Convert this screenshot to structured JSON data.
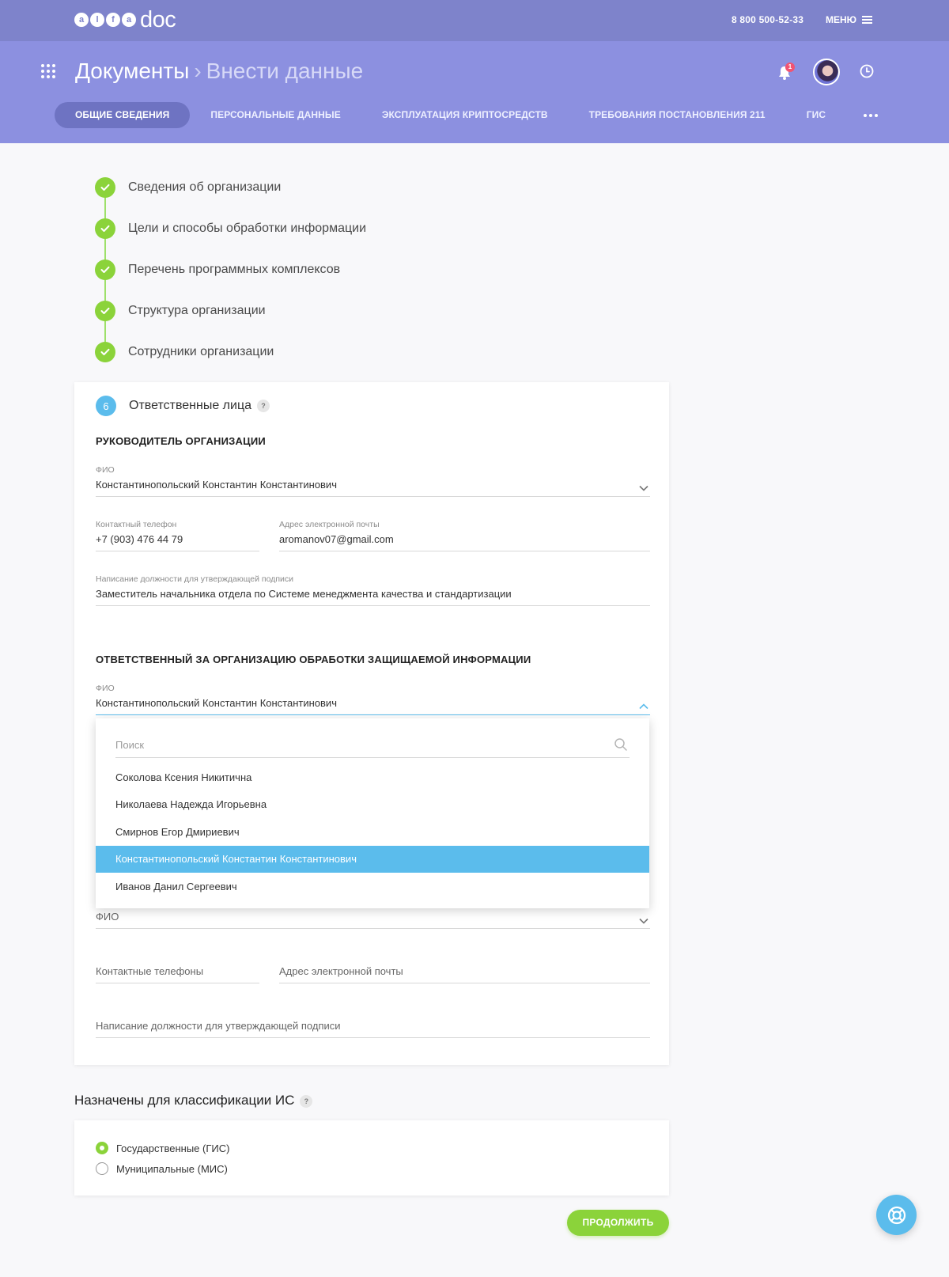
{
  "topbar": {
    "logo_letters": [
      "a",
      "l",
      "f",
      "a"
    ],
    "logo_word": "doc",
    "phone": "8 800  500-52-33",
    "menu_label": "МЕНЮ"
  },
  "header": {
    "breadcrumb_root": "Документы",
    "breadcrumb_separator": "›",
    "breadcrumb_current": "Внести данные",
    "notifications_count": "1",
    "tabs": [
      {
        "label": "ОБЩИЕ СВЕДЕНИЯ",
        "active": true
      },
      {
        "label": "ПЕРСОНАЛЬНЫЕ ДАННЫЕ",
        "active": false
      },
      {
        "label": "ЭКСПЛУАТАЦИЯ КРИПТОСРЕДСТВ",
        "active": false
      },
      {
        "label": "ТРЕБОВАНИЯ ПОСТАНОВЛЕНИЯ 211",
        "active": false
      },
      {
        "label": "ГИС",
        "active": false
      }
    ]
  },
  "steps": [
    {
      "label": "Сведения об организации",
      "done": true
    },
    {
      "label": "Цели и способы обработки информации",
      "done": true
    },
    {
      "label": "Перечень программных комплексов",
      "done": true
    },
    {
      "label": "Структура организации",
      "done": true
    },
    {
      "label": "Сотрудники организации",
      "done": true
    }
  ],
  "card": {
    "number": "6",
    "title": "Ответственные лица",
    "help": "?",
    "head": {
      "heading": "РУКОВОДИТЕЛЬ ОРГАНИЗАЦИИ",
      "fio_label": "ФИО",
      "fio_value": "Константинопольский Константин Константинович",
      "phone_label": "Контактный телефон",
      "phone_value": "+7 (903) 476 44 79",
      "email_label": "Адрес электронной почты",
      "email_value": "aromanov07@gmail.com",
      "position_label": "Написание должности для утверждающей подписи",
      "position_value": "Заместитель начальника отдела по Системе менеджмента качества и стандартизации"
    },
    "responsible": {
      "heading": "ОТВЕТСТВЕННЫЙ ЗА ОРГАНИЗАЦИЮ ОБРАБОТКИ ЗАЩИЩАЕМОЙ ИНФОРМАЦИИ",
      "fio_label": "ФИО",
      "fio_value": "Константинопольский Константин Константинович"
    },
    "third": {
      "fio_placeholder": "ФИО",
      "phones_placeholder": "Контактные телефоны",
      "email_placeholder": "Адрес электронной почты",
      "position_placeholder": "Написание должности для утверждающей подписи"
    }
  },
  "dropdown": {
    "search_placeholder": "Поиск",
    "items": [
      {
        "label": "Соколова Ксения Никитична",
        "selected": false
      },
      {
        "label": "Николаева Надежда Игорьевна",
        "selected": false
      },
      {
        "label": "Смирнов Егор Дмириевич",
        "selected": false
      },
      {
        "label": "Константинопольский Константин Константинович",
        "selected": true
      },
      {
        "label": "Иванов Данил Сергеевич",
        "selected": false
      }
    ]
  },
  "classification": {
    "title": "Назначены для классификации ИС",
    "help": "?",
    "options": [
      {
        "label": "Государственные (ГИС)",
        "checked": true
      },
      {
        "label": "Муниципальные (МИС)",
        "checked": false
      }
    ]
  },
  "actions": {
    "continue_label": "ПРОДОЛЖИТЬ"
  },
  "icons": {
    "apps": "apps-grid-icon",
    "bell": "bell-icon",
    "clock": "clock-icon",
    "check": "check-icon",
    "chevron_down": "chevron-down-icon",
    "chevron_up": "chevron-up-icon",
    "search": "search-icon",
    "help_fab": "lifebuoy-icon"
  },
  "colors": {
    "topbar": "#7e83cb",
    "header": "#8c90e0",
    "active_tab": "#6e73c2",
    "success": "#8bd33a",
    "accent": "#5bbcec",
    "badge": "#f15472"
  }
}
